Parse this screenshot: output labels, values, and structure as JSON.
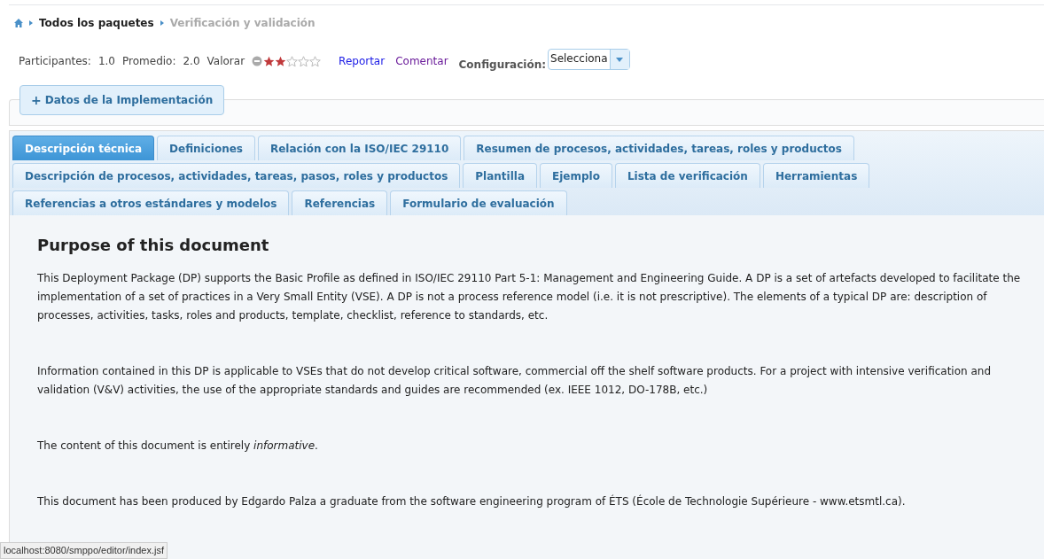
{
  "breadcrumb": [
    {
      "label": "Todos los paquetes",
      "current": false
    },
    {
      "label": "Verificación y validación",
      "current": true
    }
  ],
  "rating_bar": {
    "participants_label": "Participantes:",
    "participants": "1.0",
    "average_label": "Promedio:",
    "average": "2.0",
    "rate_label": "Valorar",
    "stars": 2,
    "links": [
      {
        "label": "Reportar",
        "visited": false
      },
      {
        "label": "Comentar",
        "visited": true
      }
    ],
    "config_label": "Configuración:",
    "config_value": "Selecciona"
  },
  "implementation_button": {
    "icon": "+",
    "label": "Datos de la Implementación"
  },
  "tab_rows": [
    [
      {
        "label": "Descripción técnica",
        "selected": true
      },
      {
        "label": "Definiciones",
        "selected": false
      },
      {
        "label": "Relación con la ISO/IEC 29110",
        "selected": false
      },
      {
        "label": "Resumen de procesos, actividades, tareas, roles y productos",
        "selected": false
      }
    ],
    [
      {
        "label": "Descripción de procesos, actividades, tareas, pasos, roles y productos",
        "selected": false
      },
      {
        "label": "Plantilla",
        "selected": false
      },
      {
        "label": "Ejemplo",
        "selected": false
      },
      {
        "label": "Lista de verificación",
        "selected": false
      },
      {
        "label": "Herramientas",
        "selected": false
      }
    ],
    [
      {
        "label": "Referencias a otros estándares y modelos",
        "selected": false
      },
      {
        "label": "Referencias",
        "selected": false
      },
      {
        "label": "Formulario de evaluación",
        "selected": false
      }
    ]
  ],
  "content": {
    "heading": "Purpose of this document",
    "paragraphs": [
      "This Deployment Package (DP) supports the Basic Profile as defined in ISO/IEC 29110 Part 5-1: Management and Engineering Guide. A DP is a set of artefacts developed to facilitate the implementation of a set of practices in a Very Small Entity (VSE). A DP is not a process reference model (i.e. it is not prescriptive). The elements of a typical DP are: description of processes, activities, tasks, roles and products, template, checklist, reference to standards, etc.",
      "Information contained in this DP is applicable to VSEs that do not develop critical software, commercial off the shelf software products. For a project with intensive verification and validation (V&V) activities, the use of the appropriate standards and guides are recommended (ex. IEEE 1012, DO-178B, etc.)",
      "The content of this document is entirely *informative*.",
      "This document has been produced by Edgardo Palza a graduate from the software engineering program of ÉTS (École de Technologie Supérieure - www.etsmtl.ca)."
    ]
  },
  "status_url": "localhost:8080/smppo/editor/index.jsf"
}
